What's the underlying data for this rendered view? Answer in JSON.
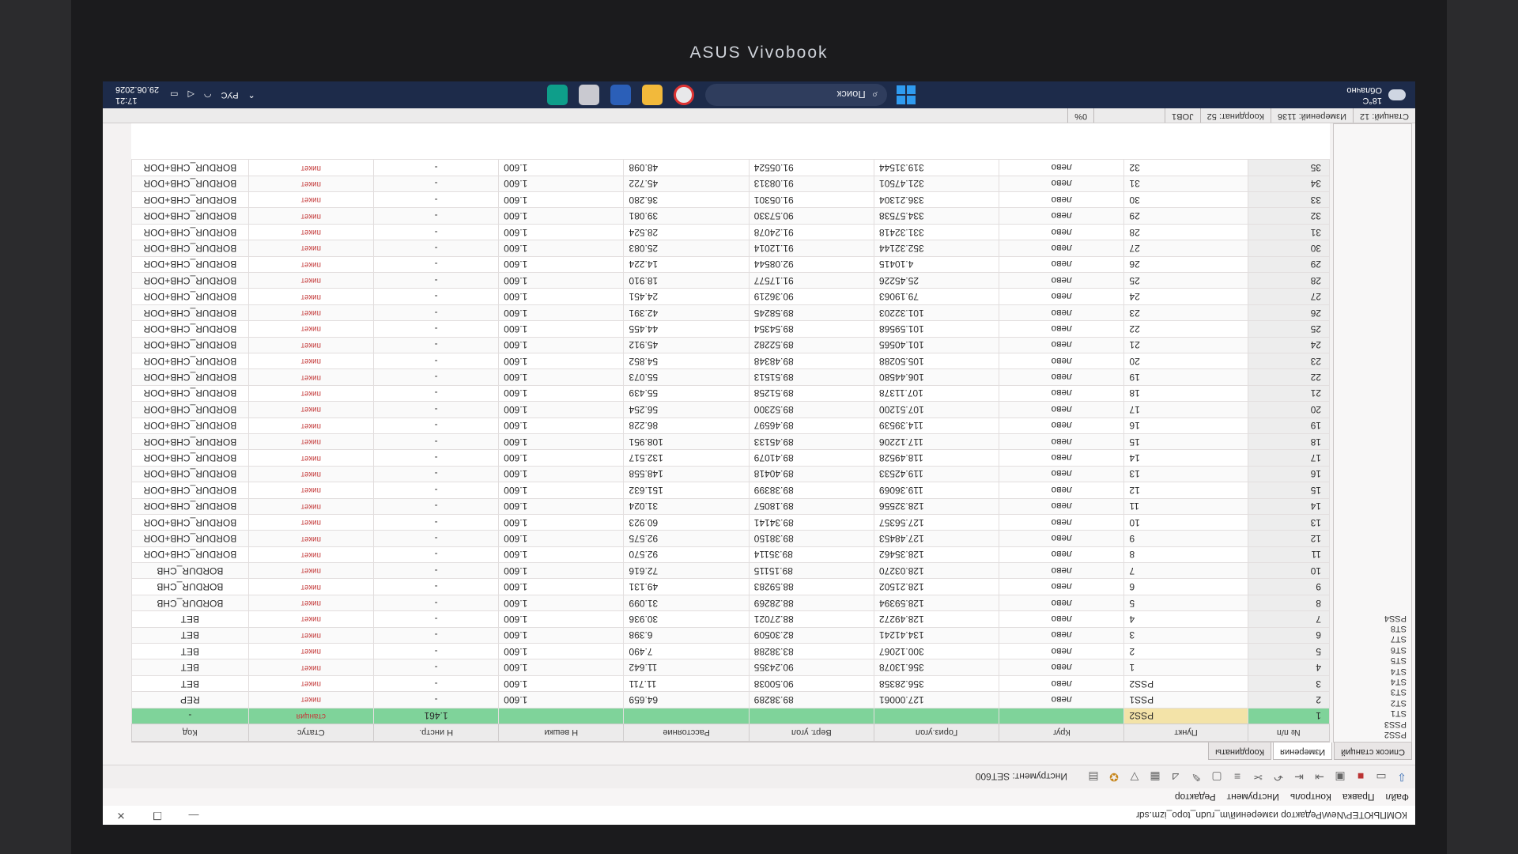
{
  "device": {
    "brand": "ASUS Vivobook"
  },
  "window": {
    "title": "КОМПЬЮТЕР\\New\\Редактор измерений\\m_rudn_topo_izm.sdr",
    "controls": [
      "—",
      "❐",
      "✕"
    ]
  },
  "menu": [
    "Файл",
    "Правка",
    "Контроль",
    "Инструмент",
    "Редактор"
  ],
  "toolbar": {
    "instrument_label": "Инструмент: SET600"
  },
  "tabs": [
    "Список станций",
    "Измерения",
    "Координаты"
  ],
  "stations": [
    "PSS2",
    "PSS3",
    "ST1",
    "ST2",
    "ST3",
    "ST4",
    "ST4",
    "ST5",
    "ST6",
    "ST7",
    "ST8",
    "PSS4"
  ],
  "table": {
    "columns": [
      "№ п/п",
      "Пункт",
      "Круг",
      "Гориз.угол",
      "Верт. угол",
      "Расстояние",
      "Н вешки",
      "Н инстр.",
      "Статус",
      "Код"
    ],
    "rows": [
      {
        "n": "1",
        "pt": "PSS2",
        "krug": "",
        "hz": "",
        "vz": "",
        "dist": "",
        "hv": "",
        "hi": "1.461",
        "status": "станция",
        "code": "-"
      },
      {
        "n": "2",
        "pt": "PSS1",
        "krug": "лево",
        "hz": "127.00061",
        "vz": "89.38289",
        "dist": "64.659",
        "hv": "1.600",
        "hi": "-",
        "status": "пикет",
        "code": "REP"
      },
      {
        "n": "3",
        "pt": "PSS2",
        "krug": "лево",
        "hz": "356.28358",
        "vz": "90.50038",
        "dist": "11.711",
        "hv": "1.600",
        "hi": "-",
        "status": "пикет",
        "code": "BET"
      },
      {
        "n": "4",
        "pt": "1",
        "krug": "лево",
        "hz": "356.13078",
        "vz": "90.24355",
        "dist": "11.642",
        "hv": "1.600",
        "hi": "-",
        "status": "пикет",
        "code": "BET"
      },
      {
        "n": "5",
        "pt": "2",
        "krug": "лево",
        "hz": "300.12067",
        "vz": "83.38288",
        "dist": "7.490",
        "hv": "1.600",
        "hi": "-",
        "status": "пикет",
        "code": "BET"
      },
      {
        "n": "6",
        "pt": "3",
        "krug": "лево",
        "hz": "134.41241",
        "vz": "82.30509",
        "dist": "6.398",
        "hv": "1.600",
        "hi": "-",
        "status": "пикет",
        "code": "BET"
      },
      {
        "n": "7",
        "pt": "4",
        "krug": "лево",
        "hz": "128.49272",
        "vz": "88.27021",
        "dist": "30.936",
        "hv": "1.600",
        "hi": "-",
        "status": "пикет",
        "code": "BET"
      },
      {
        "n": "8",
        "pt": "5",
        "krug": "лево",
        "hz": "128.59394",
        "vz": "88.28269",
        "dist": "31.099",
        "hv": "1.600",
        "hi": "-",
        "status": "пикет",
        "code": "BORDUR_CHB"
      },
      {
        "n": "9",
        "pt": "6",
        "krug": "лево",
        "hz": "128.21502",
        "vz": "88.59283",
        "dist": "49.131",
        "hv": "1.600",
        "hi": "-",
        "status": "пикет",
        "code": "BORDUR_CHB"
      },
      {
        "n": "10",
        "pt": "7",
        "krug": "лево",
        "hz": "128.03270",
        "vz": "89.15115",
        "dist": "72.616",
        "hv": "1.600",
        "hi": "-",
        "status": "пикет",
        "code": "BORDUR_CHB"
      },
      {
        "n": "11",
        "pt": "8",
        "krug": "лево",
        "hz": "128.35462",
        "vz": "89.35114",
        "dist": "92.570",
        "hv": "1.600",
        "hi": "-",
        "status": "пикет",
        "code": "BORDUR_CHB+DOR"
      },
      {
        "n": "12",
        "pt": "9",
        "krug": "лево",
        "hz": "127.48453",
        "vz": "89.38150",
        "dist": "92.575",
        "hv": "1.600",
        "hi": "-",
        "status": "пикет",
        "code": "BORDUR_CHB+DOR"
      },
      {
        "n": "13",
        "pt": "10",
        "krug": "лево",
        "hz": "127.56357",
        "vz": "89.34141",
        "dist": "60.923",
        "hv": "1.600",
        "hi": "-",
        "status": "пикет",
        "code": "BORDUR_CHB+DOR"
      },
      {
        "n": "14",
        "pt": "11",
        "krug": "лево",
        "hz": "128.32556",
        "vz": "89.18057",
        "dist": "31.024",
        "hv": "1.600",
        "hi": "-",
        "status": "пикет",
        "code": "BORDUR_CHB+DOR"
      },
      {
        "n": "15",
        "pt": "12",
        "krug": "лево",
        "hz": "119.36069",
        "vz": "89.38399",
        "dist": "151.632",
        "hv": "1.600",
        "hi": "-",
        "status": "пикет",
        "code": "BORDUR_CHB+DOR"
      },
      {
        "n": "16",
        "pt": "13",
        "krug": "лево",
        "hz": "119.42533",
        "vz": "89.40418",
        "dist": "148.558",
        "hv": "1.600",
        "hi": "-",
        "status": "пикет",
        "code": "BORDUR_CHB+DOR"
      },
      {
        "n": "17",
        "pt": "14",
        "krug": "лево",
        "hz": "118.49528",
        "vz": "89.41079",
        "dist": "132.517",
        "hv": "1.600",
        "hi": "-",
        "status": "пикет",
        "code": "BORDUR_CHB+DOR"
      },
      {
        "n": "18",
        "pt": "15",
        "krug": "лево",
        "hz": "117.12206",
        "vz": "89.45133",
        "dist": "108.951",
        "hv": "1.600",
        "hi": "-",
        "status": "пикет",
        "code": "BORDUR_CHB+DOR"
      },
      {
        "n": "19",
        "pt": "16",
        "krug": "лево",
        "hz": "114.39539",
        "vz": "89.46597",
        "dist": "86.228",
        "hv": "1.600",
        "hi": "-",
        "status": "пикет",
        "code": "BORDUR_CHB+DOR"
      },
      {
        "n": "20",
        "pt": "17",
        "krug": "лево",
        "hz": "107.51200",
        "vz": "89.52300",
        "dist": "56.254",
        "hv": "1.600",
        "hi": "-",
        "status": "пикет",
        "code": "BORDUR_CHB+DOR"
      },
      {
        "n": "21",
        "pt": "18",
        "krug": "лево",
        "hz": "107.11378",
        "vz": "89.51258",
        "dist": "55.439",
        "hv": "1.600",
        "hi": "-",
        "status": "пикет",
        "code": "BORDUR_CHB+DOR"
      },
      {
        "n": "22",
        "pt": "19",
        "krug": "лево",
        "hz": "106.44580",
        "vz": "89.51513",
        "dist": "55.073",
        "hv": "1.600",
        "hi": "-",
        "status": "пикет",
        "code": "BORDUR_CHB+DOR"
      },
      {
        "n": "23",
        "pt": "20",
        "krug": "лево",
        "hz": "105.50288",
        "vz": "89.48348",
        "dist": "54.852",
        "hv": "1.600",
        "hi": "-",
        "status": "пикет",
        "code": "BORDUR_CHB+DOR"
      },
      {
        "n": "24",
        "pt": "21",
        "krug": "лево",
        "hz": "101.40565",
        "vz": "89.52282",
        "dist": "45.912",
        "hv": "1.600",
        "hi": "-",
        "status": "пикет",
        "code": "BORDUR_CHB+DOR"
      },
      {
        "n": "25",
        "pt": "22",
        "krug": "лево",
        "hz": "101.59568",
        "vz": "89.54354",
        "dist": "44.455",
        "hv": "1.600",
        "hi": "-",
        "status": "пикет",
        "code": "BORDUR_CHB+DOR"
      },
      {
        "n": "26",
        "pt": "23",
        "krug": "лево",
        "hz": "101.32203",
        "vz": "89.58245",
        "dist": "42.391",
        "hv": "1.600",
        "hi": "-",
        "status": "пикет",
        "code": "BORDUR_CHB+DOR"
      },
      {
        "n": "27",
        "pt": "24",
        "krug": "лево",
        "hz": "79.19063",
        "vz": "90.36219",
        "dist": "24.451",
        "hv": "1.600",
        "hi": "-",
        "status": "пикет",
        "code": "BORDUR_CHB+DOR"
      },
      {
        "n": "28",
        "pt": "25",
        "krug": "лево",
        "hz": "25.45226",
        "vz": "91.17577",
        "dist": "18.910",
        "hv": "1.600",
        "hi": "-",
        "status": "пикет",
        "code": "BORDUR_CHB+DOR"
      },
      {
        "n": "29",
        "pt": "26",
        "krug": "лево",
        "hz": "4.10415",
        "vz": "92.08544",
        "dist": "14.224",
        "hv": "1.600",
        "hi": "-",
        "status": "пикет",
        "code": "BORDUR_CHB+DOR"
      },
      {
        "n": "30",
        "pt": "27",
        "krug": "лево",
        "hz": "352.32144",
        "vz": "91.12014",
        "dist": "25.083",
        "hv": "1.600",
        "hi": "-",
        "status": "пикет",
        "code": "BORDUR_CHB+DOR"
      },
      {
        "n": "31",
        "pt": "28",
        "krug": "лево",
        "hz": "331.32418",
        "vz": "91.24078",
        "dist": "28.524",
        "hv": "1.600",
        "hi": "-",
        "status": "пикет",
        "code": "BORDUR_CHB+DOR"
      },
      {
        "n": "32",
        "pt": "29",
        "krug": "лево",
        "hz": "334.57538",
        "vz": "90.57330",
        "dist": "39.081",
        "hv": "1.600",
        "hi": "-",
        "status": "пикет",
        "code": "BORDUR_CHB+DOR"
      },
      {
        "n": "33",
        "pt": "30",
        "krug": "лево",
        "hz": "336.21304",
        "vz": "91.05301",
        "dist": "36.280",
        "hv": "1.600",
        "hi": "-",
        "status": "пикет",
        "code": "BORDUR_CHB+DOR"
      },
      {
        "n": "34",
        "pt": "31",
        "krug": "лево",
        "hz": "321.47501",
        "vz": "91.08313",
        "dist": "45.722",
        "hv": "1.600",
        "hi": "-",
        "status": "пикет",
        "code": "BORDUR_CHB+DOR"
      },
      {
        "n": "35",
        "pt": "32",
        "krug": "лево",
        "hz": "319.31544",
        "vz": "91.05524",
        "dist": "48.098",
        "hv": "1.600",
        "hi": "-",
        "status": "пикет",
        "code": "BORDUR_CHB+DOR"
      }
    ]
  },
  "statusbar": [
    "Станций: 12",
    "Измерений: 1136",
    "Координат: 52",
    "JOB1",
    "",
    "0%"
  ],
  "taskbar": {
    "weather_temp": "18°C",
    "weather_desc": "Облачно",
    "search_placeholder": "Поиск",
    "lang": "РУС",
    "time": "17:21",
    "date": "29.06.2026"
  },
  "colors": {
    "highlight_row": "#7fd39a",
    "station_cell": "#f3e3a8",
    "status_text": "#c43a3a",
    "taskbar": "#1d2b4a"
  }
}
